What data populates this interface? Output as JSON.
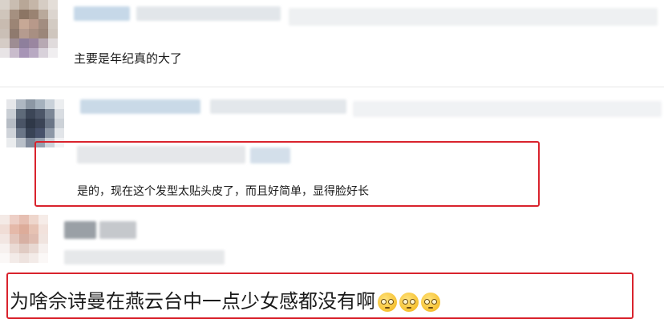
{
  "comments": [
    {
      "text": "主要是年纪真的大了"
    },
    {
      "text": "是的，现在这个发型太贴头皮了，而且好简单，显得脸好长"
    },
    {
      "text": "为啥佘诗曼在燕云台中一点少女感都没有啊",
      "emojis": [
        "dizzy-face-icon",
        "dizzy-face-icon",
        "dizzy-face-icon"
      ]
    }
  ],
  "colors": {
    "highlight": "#d9232d",
    "text": "#1a1a1a",
    "divider": "#e6e6e6"
  }
}
